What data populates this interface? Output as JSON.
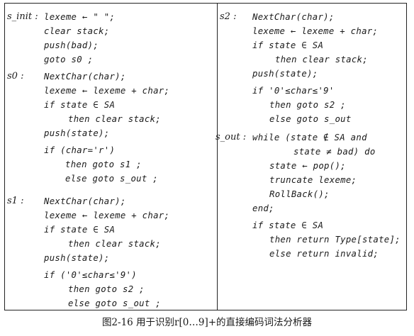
{
  "labels": {
    "s_init": "s_init :",
    "s0": "s0 :",
    "s1": "s1 :",
    "s2": "s2 :",
    "s_out": "s_out :"
  },
  "left_column": [
    "lexeme ← \" \";",
    "clear stack;",
    "push(bad);",
    "goto s0 ;",
    "NextChar(char);",
    "lexeme ← lexeme + char;",
    "if state ∈ SA",
    "then clear stack;",
    "push(state);",
    "if (char='r')",
    "then goto s1 ;",
    "else goto s_out ;",
    "NextChar(char);",
    "lexeme ← lexeme + char;",
    "if state ∈ SA",
    "then clear stack;",
    "push(state);",
    "if ('0'≤char≤'9')",
    "then goto s2 ;",
    "else goto s_out ;"
  ],
  "right_column": [
    "NextChar(char);",
    "lexeme ← lexeme + char;",
    "if state ∈ SA",
    "then clear stack;",
    "push(state);",
    "if '0'≤char≤'9'",
    "then goto s2 ;",
    "else goto s_out",
    "while (state ∉ SA and",
    "state ≠ bad) do",
    "state ← pop();",
    "truncate lexeme;",
    "RollBack();",
    "end;",
    "if state ∈ SA",
    "then return Type[state];",
    "else return invalid;"
  ],
  "caption": "图2-16   用于识别r[0…9]+的直接编码词法分析器"
}
